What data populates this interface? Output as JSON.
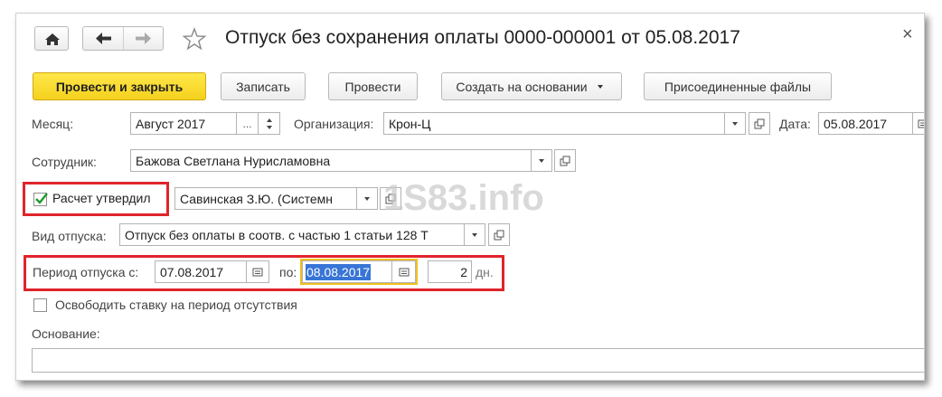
{
  "window": {
    "title": "Отпуск без сохранения оплаты 0000-000001 от 05.08.2017",
    "close_glyph": "×"
  },
  "toolbar": {
    "post_close_label": "Провести и закрыть",
    "save_label": "Записать",
    "post_label": "Провести",
    "create_based_label": "Создать на основании",
    "attached_files_label": "Присоединенные файлы"
  },
  "form": {
    "month_label": "Месяц:",
    "month_value": "Август 2017",
    "month_ellipsis": "...",
    "organization_label": "Организация:",
    "organization_value": "Крон-Ц",
    "date_label": "Дата:",
    "date_value": "05.08.2017",
    "employee_label": "Сотрудник:",
    "employee_value": "Бажова Светлана Нурисламовна",
    "approved_label": "Расчет утвердил",
    "approved_checked": true,
    "approver_value": "Савинская З.Ю. (Системн",
    "leave_type_label": "Вид отпуска:",
    "leave_type_value": "Отпуск без оплаты в соотв. с частью 1 статьи 128 Т",
    "period_from_label": "Период отпуска с:",
    "period_from_value": "07.08.2017",
    "period_to_label": "по:",
    "period_to_value": "08.08.2017",
    "days_value": "2",
    "days_unit": "дн.",
    "release_rate_label": "Освободить ставку на период отсутствия",
    "release_rate_checked": false,
    "basis_label": "Основание:",
    "basis_value": ""
  },
  "watermark": "1S83.info",
  "colors": {
    "primary_button": "#f5d11d",
    "highlight_box": "#e0242c",
    "selection": "#3875d7",
    "focus_border": "#f0c020"
  }
}
